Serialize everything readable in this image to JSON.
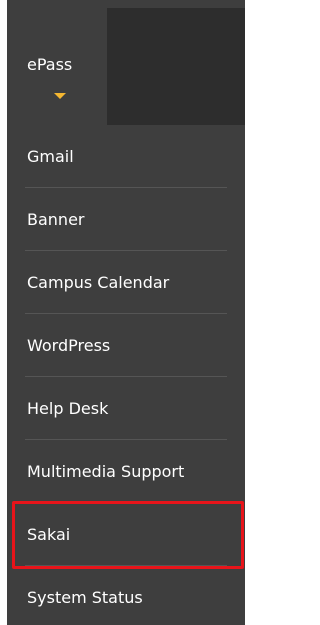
{
  "header": {
    "active_tab_label": "ePass"
  },
  "menu": {
    "items": [
      {
        "label": "Gmail"
      },
      {
        "label": "Banner"
      },
      {
        "label": "Campus Calendar"
      },
      {
        "label": "WordPress"
      },
      {
        "label": "Help Desk"
      },
      {
        "label": "Multimedia Support"
      },
      {
        "label": "Sakai"
      },
      {
        "label": "System Status"
      }
    ],
    "highlighted_item": "Sakai"
  },
  "colors": {
    "panel_bg": "#3e3e3e",
    "dark_block": "#2d2d2d",
    "caret": "#f5b731",
    "highlight_border": "#e8141a",
    "text": "#ffffff"
  }
}
